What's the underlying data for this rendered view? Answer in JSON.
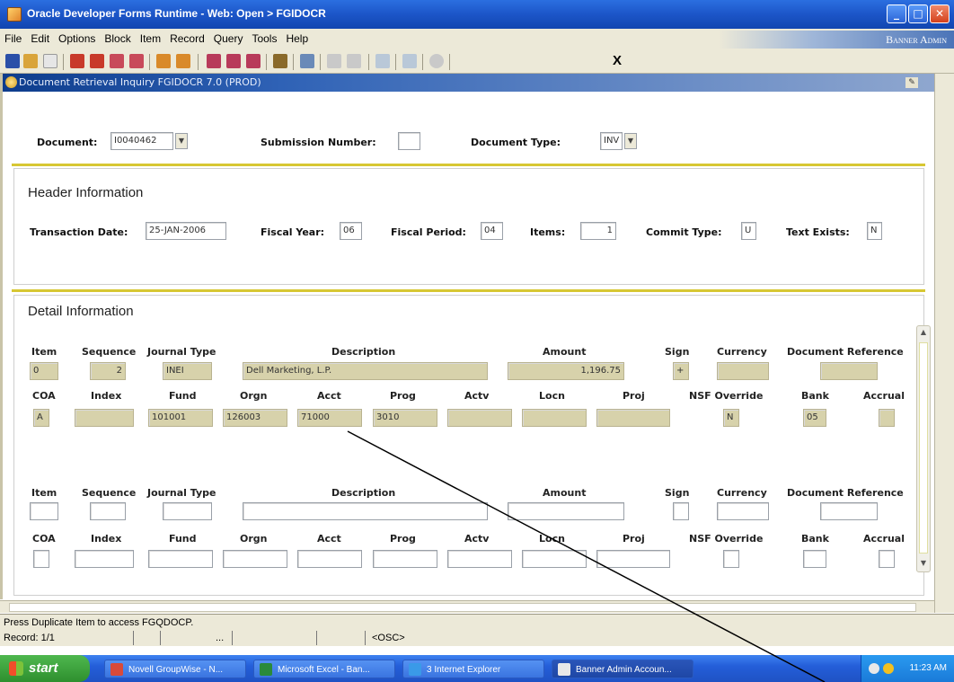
{
  "window": {
    "title": "Oracle Developer Forms Runtime - Web:  Open > FGIDOCR",
    "min": "_",
    "max": "□",
    "close": "✕"
  },
  "menu": {
    "items": [
      "File",
      "Edit",
      "Options",
      "Block",
      "Item",
      "Record",
      "Query",
      "Tools",
      "Help"
    ],
    "brand": "Banner Admin"
  },
  "toolbar": {
    "exit": "X"
  },
  "form": {
    "title": "Document Retrieval Inquiry  FGIDOCR  7.0  (PROD)",
    "key_block": {
      "document_label": "Document:",
      "document_value": "I0040462",
      "submission_label": "Submission Number:",
      "submission_value": "",
      "doctype_label": "Document Type:",
      "doctype_value": "INV"
    },
    "header": {
      "title": "Header Information",
      "trans_date_label": "Transaction Date:",
      "trans_date": "25-JAN-2006",
      "fiscal_year_label": "Fiscal Year:",
      "fiscal_year": "06",
      "fiscal_period_label": "Fiscal Period:",
      "fiscal_period": "04",
      "items_label": "Items:",
      "items": "1",
      "commit_label": "Commit Type:",
      "commit": "U",
      "text_label": "Text Exists:",
      "text": "N"
    },
    "detail": {
      "title": "Detail Information",
      "cols1": [
        "Item",
        "Sequence",
        "Journal Type",
        "Description",
        "Amount",
        "Sign",
        "Currency",
        "Document Reference"
      ],
      "cols2": [
        "COA",
        "Index",
        "Fund",
        "Orgn",
        "Acct",
        "Prog",
        "Actv",
        "Locn",
        "Proj",
        "NSF Override",
        "Bank",
        "Accrual"
      ],
      "rec1": {
        "item": "0",
        "sequence": "2",
        "journal_type": "INEI",
        "description": "Dell Marketing, L.P.",
        "amount": "1,196.75",
        "sign": "+",
        "currency": "",
        "doc_ref": "",
        "coa": "A",
        "index": "",
        "fund": "101001",
        "orgn": "126003",
        "acct": "71000",
        "prog": "3010",
        "actv": "",
        "locn": "",
        "proj": "",
        "nsf": "N",
        "bank": "05",
        "accrual": ""
      }
    }
  },
  "status": {
    "message": "Press Duplicate Item to access FGQDOCP.",
    "record": "Record: 1/1",
    "dots": "...",
    "osc": "<OSC>"
  },
  "taskbar": {
    "start": "start",
    "tasks": [
      "Novell GroupWise - N...",
      "Microsoft Excel - Ban...",
      "3 Internet Explorer",
      "Banner Admin Accoun..."
    ],
    "clock": "11:23 AM"
  },
  "colors": {
    "field_filled": "#d7d2ab",
    "rule": "#d7c733",
    "title_blue": "#1c55c8"
  }
}
